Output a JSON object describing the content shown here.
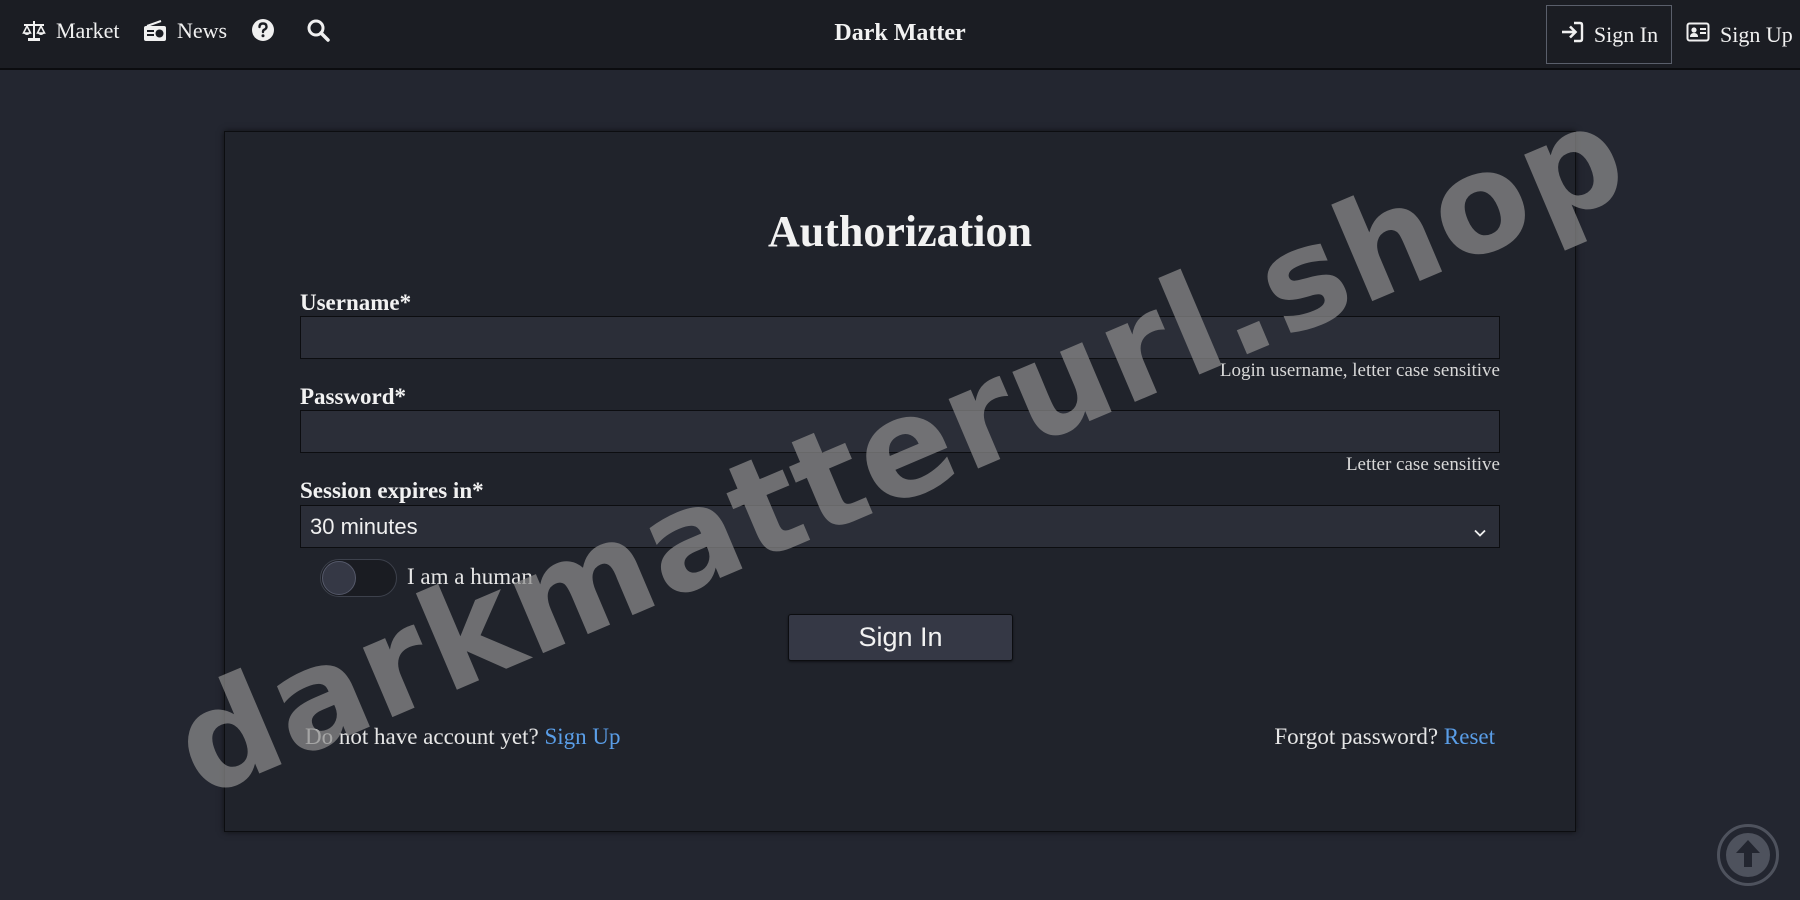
{
  "nav": {
    "market": "Market",
    "news": "News",
    "brand": "Dark Matter",
    "sign_in": "Sign In",
    "sign_up": "Sign Up"
  },
  "form": {
    "title": "Authorization",
    "username_label": "Username*",
    "username_value": "",
    "username_help": "Login username, letter case sensitive",
    "password_label": "Password*",
    "password_value": "",
    "password_help": "Letter case sensitive",
    "session_label": "Session expires in*",
    "session_value": "30 minutes",
    "human_label": "I am a human",
    "human_checked": false,
    "submit": "Sign In",
    "no_account_text": "Do not have account yet?",
    "signup_link": "Sign Up",
    "forgot_text": "Forgot password?",
    "reset_link": "Reset"
  },
  "watermark": "darkmatterurl.shop",
  "icons": {
    "market": "balance-scale-icon",
    "news": "radio-icon",
    "help": "question-circle-icon",
    "search": "search-icon",
    "sign_in": "sign-in-icon",
    "sign_up": "id-card-icon",
    "scroll_top": "arrow-up-circle-icon"
  },
  "colors": {
    "background": "#232630",
    "topbar": "#1b1d23",
    "panel": "#20232b",
    "input": "#2b2e38",
    "link": "#5a9ee8"
  }
}
